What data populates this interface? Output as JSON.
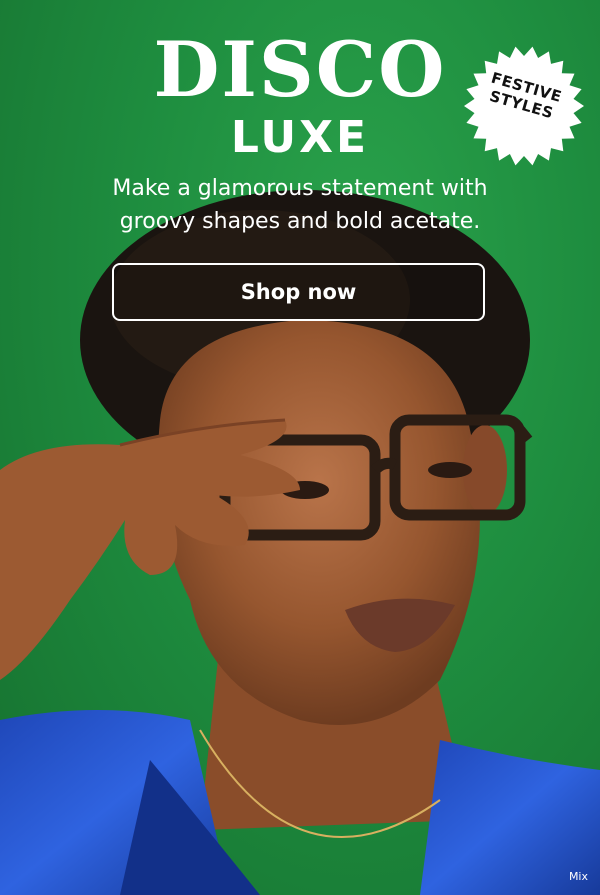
{
  "banner": {
    "title_line1": "DISCO",
    "title_line2": "LUXE",
    "subtitle": "Make a glamorous statement with groovy shapes and bold acetate.",
    "cta_label": "Shop now",
    "badge_line1": "FESTIVE",
    "badge_line2": "STYLES",
    "corner_mark": "Mix"
  },
  "colors": {
    "background": "#1e8d3f",
    "text": "#ffffff",
    "badge": "#ffffff",
    "badge_text": "#111111"
  },
  "icons": {
    "disco_sparkle": "sparkle-icon"
  }
}
